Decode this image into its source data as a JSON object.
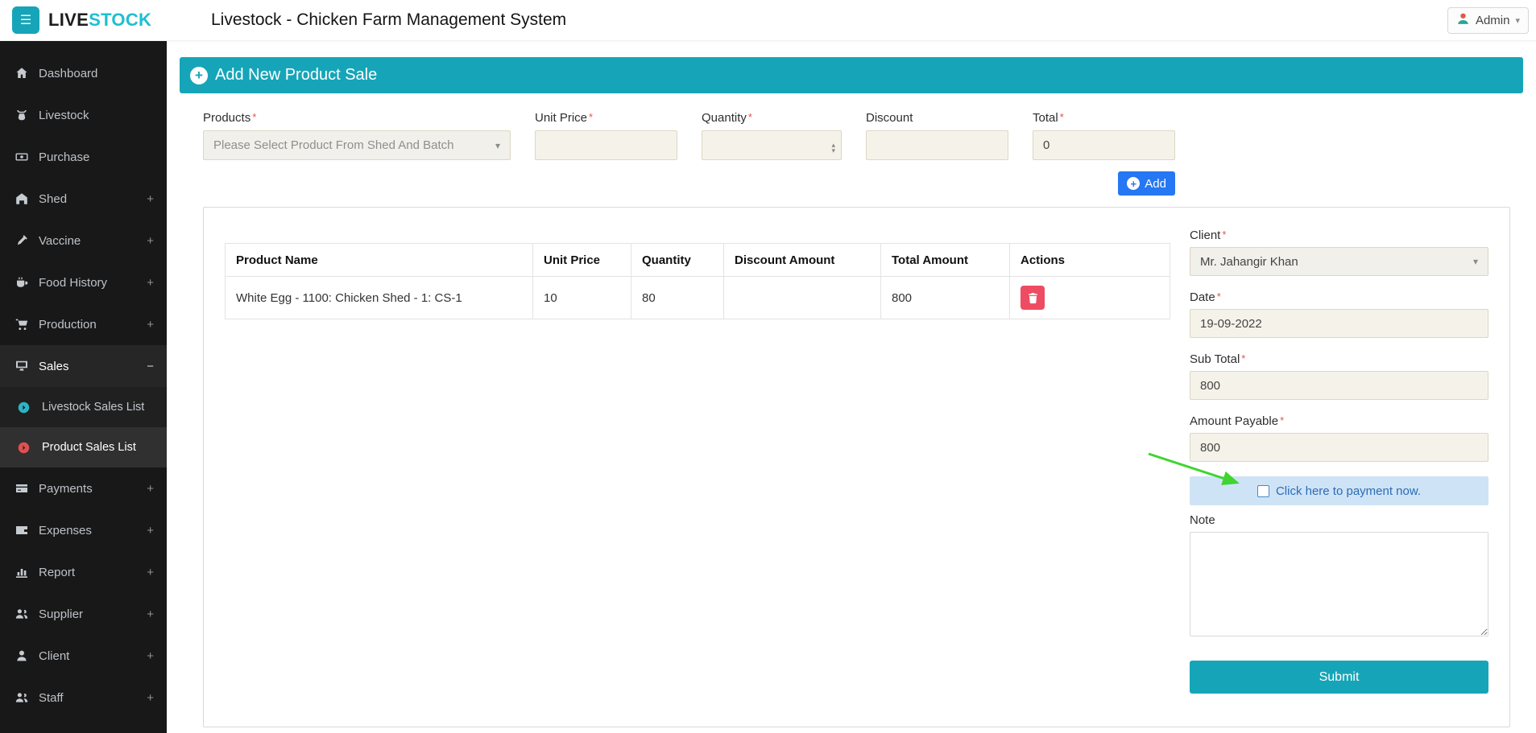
{
  "topbar": {
    "logo_prefix": "LIVE",
    "logo_suffix": "STOCK",
    "title": "Livestock - Chicken Farm Management System",
    "admin_label": "Admin"
  },
  "sidebar": {
    "items": [
      {
        "label": "Dashboard",
        "suffix": ""
      },
      {
        "label": "Livestock",
        "suffix": ""
      },
      {
        "label": "Purchase",
        "suffix": ""
      },
      {
        "label": "Shed",
        "suffix": "+"
      },
      {
        "label": "Vaccine",
        "suffix": "+"
      },
      {
        "label": "Food History",
        "suffix": "+"
      },
      {
        "label": "Production",
        "suffix": "+"
      },
      {
        "label": "Sales",
        "suffix": "−"
      },
      {
        "label": "Payments",
        "suffix": "+"
      },
      {
        "label": "Expenses",
        "suffix": "+"
      },
      {
        "label": "Report",
        "suffix": "+"
      },
      {
        "label": "Supplier",
        "suffix": "+"
      },
      {
        "label": "Client",
        "suffix": "+"
      },
      {
        "label": "Staff",
        "suffix": "+"
      }
    ],
    "sales_submenu": [
      {
        "label": "Livestock Sales List"
      },
      {
        "label": "Product Sales List"
      }
    ]
  },
  "page": {
    "heading": "Add New Product Sale"
  },
  "entry_form": {
    "products": {
      "label": "Products",
      "value": "Please Select Product From Shed And Batch"
    },
    "unit_price": {
      "label": "Unit Price",
      "value": ""
    },
    "quantity": {
      "label": "Quantity",
      "value": ""
    },
    "discount": {
      "label": "Discount",
      "value": ""
    },
    "total": {
      "label": "Total",
      "value": "0"
    },
    "add_button": "Add"
  },
  "table": {
    "headers": [
      "Product Name",
      "Unit Price",
      "Quantity",
      "Discount Amount",
      "Total Amount",
      "Actions"
    ],
    "rows": [
      {
        "product_name": "White Egg - 1100: Chicken Shed - 1: CS-1",
        "unit_price": "10",
        "quantity": "80",
        "discount_amount": "",
        "total_amount": "800"
      }
    ]
  },
  "sale_form": {
    "client": {
      "label": "Client",
      "value": "Mr. Jahangir Khan"
    },
    "date": {
      "label": "Date",
      "value": "19-09-2022"
    },
    "sub_total": {
      "label": "Sub Total",
      "value": "800"
    },
    "amount_payable": {
      "label": "Amount Payable",
      "value": "800"
    },
    "payment": {
      "label": "Click here to payment now.",
      "checked": false
    },
    "note": {
      "label": "Note",
      "value": ""
    },
    "submit_label": "Submit"
  },
  "ui": {
    "required_mark": "*",
    "caret": "▾",
    "plus": "+",
    "spinner_up": "▴",
    "spinner_down": "▾"
  },
  "icons": {
    "hamburger": "☰"
  },
  "colors": {
    "teal": "#16a5b8",
    "logo-teal": "#1cc0d0",
    "blue": "#2577f3",
    "red": "#ee4c63",
    "arrow-green": "#3fd42f",
    "input-bg": "#f5f3e9",
    "payment-bg": "#cfe3f7",
    "payment-text": "#2a6db5",
    "sidebar-bg": "#181818"
  }
}
